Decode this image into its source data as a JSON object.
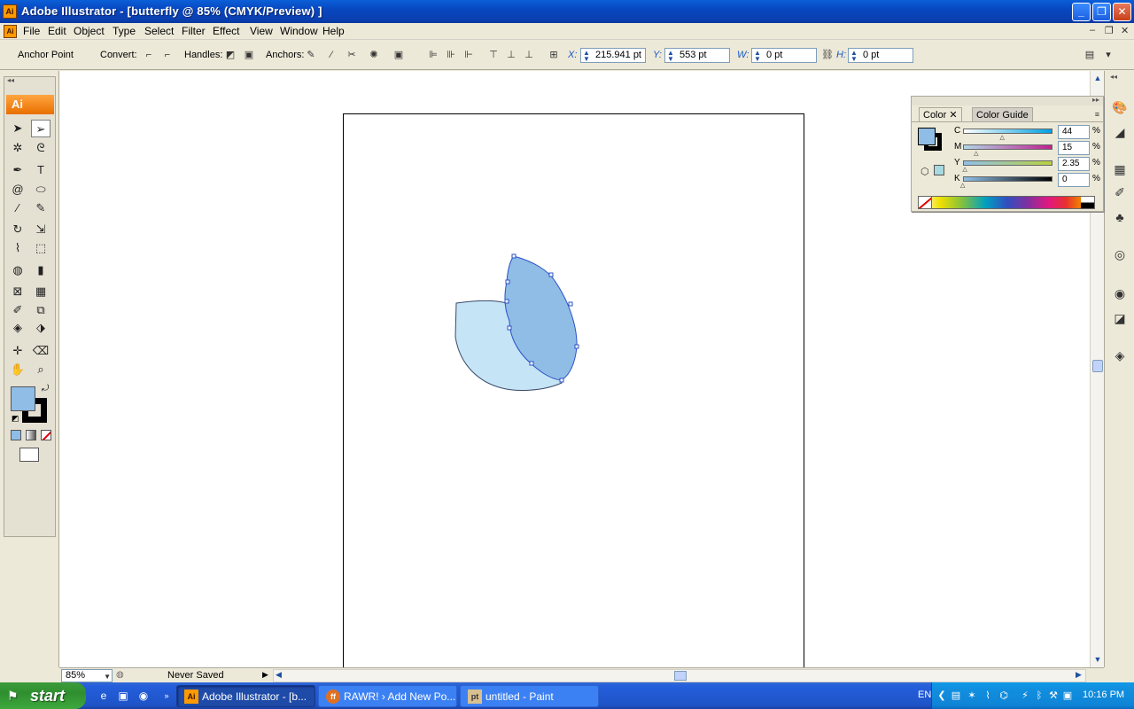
{
  "window": {
    "app_icon": "Ai",
    "title": "Adobe Illustrator - [butterfly @ 85% (CMYK/Preview) ]",
    "buttons": {
      "minimize": "_",
      "maximize": "❐",
      "close": "✕"
    }
  },
  "menu": {
    "items": [
      "File",
      "Edit",
      "Object",
      "Type",
      "Select",
      "Filter",
      "Effect",
      "View",
      "Window",
      "Help"
    ],
    "doc_controls": [
      "–",
      "❐",
      "✕"
    ]
  },
  "controlbar": {
    "tool_label": "Anchor Point",
    "convert_label": "Convert:",
    "handles_label": "Handles:",
    "anchors_label": "Anchors:",
    "x_label": "X:",
    "x_value": "215.941 pt",
    "y_label": "Y:",
    "y_value": "553 pt",
    "w_label": "W:",
    "w_value": "0 pt",
    "h_label": "H:",
    "h_value": "0 pt"
  },
  "tools": {
    "badge": "Ai",
    "items": [
      "selection-tool",
      "direct-selection-tool",
      "magic-wand-tool",
      "lasso-tool",
      "pen-tool",
      "type-tool",
      "spiral-tool",
      "ellipse-tool",
      "paintbrush-tool",
      "pencil-tool",
      "rotate-tool",
      "scale-tool",
      "warp-tool",
      "free-transform-tool",
      "symbol-sprayer-tool",
      "column-graph-tool",
      "mesh-tool",
      "gradient-tool",
      "eyedropper-tool",
      "blend-tool",
      "live-paint-bucket-tool",
      "live-paint-selection-tool",
      "slice-tool",
      "eraser-tool",
      "hand-tool",
      "zoom-tool"
    ]
  },
  "color_panel": {
    "tabs": [
      "Color",
      "Color Guide"
    ],
    "fill_color": "#8fbde5",
    "channels": [
      {
        "name": "C",
        "value": "44",
        "unit": "%",
        "level": 0.44,
        "gradient": [
          "#ffffff",
          "#00a0e0"
        ]
      },
      {
        "name": "M",
        "value": "15",
        "unit": "%",
        "level": 0.15,
        "gradient": [
          "#b0d8e8",
          "#c02090"
        ]
      },
      {
        "name": "Y",
        "value": "2.35",
        "unit": "%",
        "level": 0.0235,
        "gradient": [
          "#90c0e8",
          "#b8d040"
        ]
      },
      {
        "name": "K",
        "value": "0",
        "unit": "%",
        "level": 0.0,
        "gradient": [
          "#90c0e8",
          "#000000"
        ]
      }
    ]
  },
  "status": {
    "zoom": "85%",
    "save_state": "Never Saved"
  },
  "artwork": {
    "back_petal_fill": "#c5e4f5",
    "front_petal_fill": "#8fbde5",
    "selection_color": "#2a50c8"
  },
  "taskbar": {
    "start_label": "start",
    "tasks": [
      {
        "label": "Adobe Illustrator - [b...",
        "icon": "Ai",
        "active": true
      },
      {
        "label": "RAWR! › Add New Po...",
        "icon": "ff",
        "active": false
      },
      {
        "label": "untitled - Paint",
        "icon": "pt",
        "active": false
      }
    ],
    "language": "EN",
    "clock": "10:16 PM"
  }
}
